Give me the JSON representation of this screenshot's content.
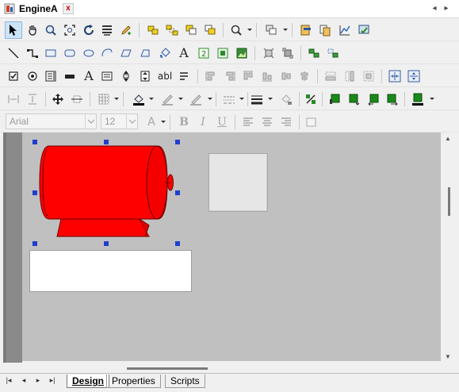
{
  "document": {
    "title": "EngineA",
    "close_glyph": "x"
  },
  "toolbar": {
    "row1": [
      "pointer-icon",
      "pan-hand-icon",
      "zoom-area-icon",
      "zoom-fit-icon",
      "refresh-icon",
      "bring-list-icon",
      "edit-pencil-icon",
      "group-icon",
      "ungroup-icon",
      "send-back-icon",
      "bring-front-icon",
      "zoom-icon",
      "layers-icon",
      "properties-icon",
      "copy-doc-icon",
      "chart-icon",
      "picture-check-icon"
    ],
    "row2": [
      "line-icon",
      "connector-icon",
      "rectangle-icon",
      "rounded-rect-icon",
      "ellipse-icon",
      "arc-icon",
      "parallelogram-icon",
      "polygon-icon",
      "fill-bucket-icon",
      "text-tool-icon",
      "numeric-display-icon",
      "alarm-display-icon",
      "image-tool-icon",
      "rotate-icon",
      "resize-icon",
      "align-group-icon",
      "distribute-group-icon"
    ],
    "row3_glyphs": {
      "text_a": "A",
      "abl": "abl"
    },
    "row5": {
      "font_family": "Arial",
      "font_size": "12",
      "bold": "B",
      "italic": "I",
      "underline": "U",
      "font_color_glyph": "A"
    }
  },
  "canvas": {
    "object_name": "motor-symbol",
    "colors": {
      "motor_fill": "#ff0000",
      "canvas_bg": "#c0c0c0",
      "selection_handle": "#1f3fcc"
    }
  },
  "tabs": [
    {
      "label": "Design",
      "active": true
    },
    {
      "label": "Properties",
      "active": false
    },
    {
      "label": "Scripts",
      "active": false
    }
  ],
  "nav": {
    "first": "|◂",
    "prev": "◂",
    "next": "▸",
    "last": "▸|"
  }
}
